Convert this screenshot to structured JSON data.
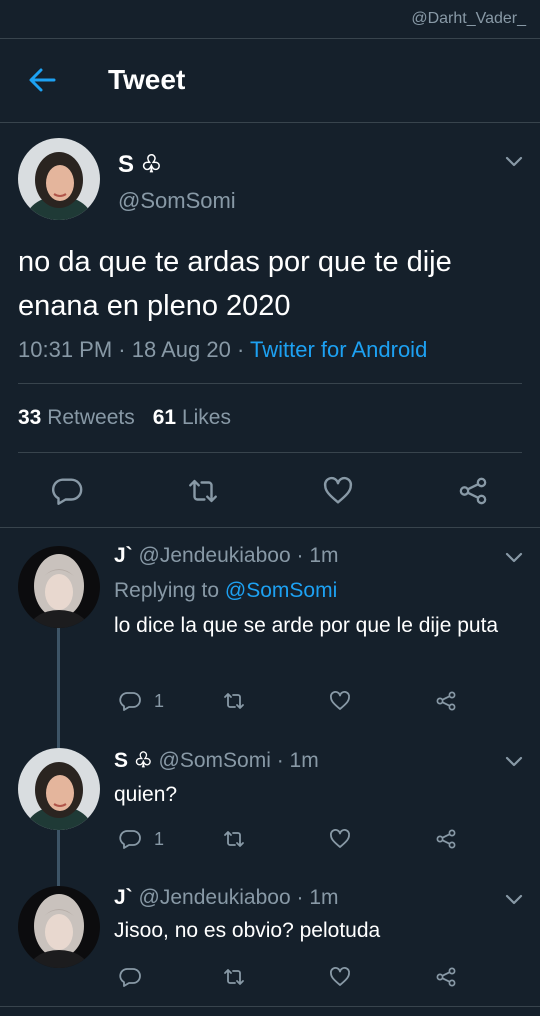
{
  "watermark": "@Darht_Vader_",
  "header": {
    "title": "Tweet"
  },
  "tweet": {
    "name": "S ♧",
    "handle": "@SomSomi",
    "text": "no da que te ardas por que te dije enana en pleno 2020",
    "time": "10:31 PM",
    "date": "18 Aug 20",
    "source": "Twitter for Android",
    "retweets_count": "33",
    "retweets_label": "Retweets",
    "likes_count": "61",
    "likes_label": "Likes"
  },
  "replies": [
    {
      "name": "J`",
      "handle": "@Jendeukiaboo",
      "time": "1m",
      "replying_label": "Replying to",
      "replying_to": "@SomSomi",
      "text": "lo dice la que se arde por que le dije puta",
      "reply_count": "1"
    },
    {
      "name": "S ♧",
      "handle": "@SomSomi",
      "time": "1m",
      "text": "quien?",
      "reply_count": "1"
    },
    {
      "name": "J`",
      "handle": "@Jendeukiaboo",
      "time": "1m",
      "text": "Jisoo, no es obvio? pelotuda",
      "reply_count": ""
    }
  ],
  "colors": {
    "background": "#15202b",
    "accent": "#1da1f2",
    "secondary_text": "#8899a6",
    "divider": "#38444d"
  },
  "icons": [
    "back-arrow-icon",
    "chevron-down-icon",
    "reply-icon",
    "retweet-icon",
    "like-icon",
    "share-icon"
  ]
}
